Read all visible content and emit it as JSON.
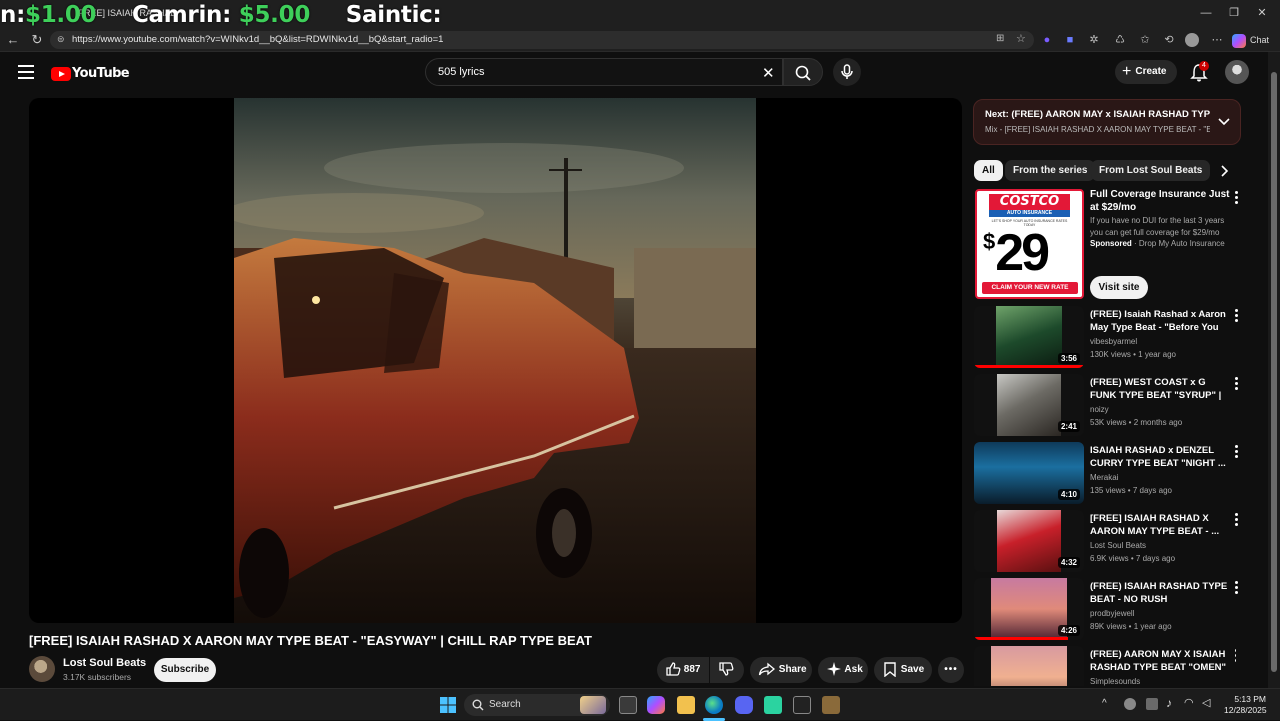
{
  "stream_overlay": {
    "segments": [
      {
        "prefix": "n:",
        "amount": "$1.00"
      },
      {
        "prefix": "Camrin:",
        "amount": "$5.00"
      },
      {
        "prefix": "Saintic:",
        "amount": ""
      }
    ]
  },
  "browser": {
    "tab_title": "[FREE] ISAIAH RASHAD",
    "url": "https://www.youtube.com/watch?v=WINkv1d__bQ&list=RDWINkv1d__bQ&start_radio=1",
    "chat_label": "Chat"
  },
  "youtube": {
    "logo_text": "YouTube",
    "search_value": "505 lyrics",
    "create_label": "Create",
    "notification_count": "4"
  },
  "video": {
    "title": "[FREE] ISAIAH RASHAD X AARON MAY TYPE BEAT - \"EASYWAY\" | CHILL RAP TYPE BEAT",
    "channel": "Lost Soul Beats",
    "subscribers": "3.17K subscribers",
    "subscribe_label": "Subscribe",
    "likes": "887",
    "share_label": "Share",
    "ask_label": "Ask",
    "save_label": "Save"
  },
  "sidebar": {
    "next_title": "Next: (FREE) AARON MAY x ISAIAH RASHAD TYPE ...",
    "next_sub": "Mix - [FREE] ISAIAH RASHAD X AARON MAY TYPE BEAT - \"E...",
    "chips": [
      "All",
      "From the series",
      "From Lost Soul Beats"
    ],
    "ad": {
      "logo": "COSTCO",
      "logo_sub": "AUTO INSURANCE",
      "tagline": "LET'S SHOP YOUR AUTO INSURANCE RATES TODAY",
      "price_symbol": "$",
      "price": "29",
      "cta": "CLAIM YOUR NEW RATE",
      "title": "Full Coverage Insurance Just at $29/mo",
      "description": "If you have no DUI for the last 3 years you can get full coverage for $29/mo",
      "sponsored": "Sponsored",
      "advertiser": "Drop My Auto Insurance",
      "visit_label": "Visit site"
    },
    "recommendations": [
      {
        "title": "(FREE) Isaiah Rashad x Aaron May Type Beat - \"Before You Go\"",
        "channel": "vibesbyarmel",
        "meta": "130K views • 1 year ago",
        "duration": "3:56",
        "watched": 1.0
      },
      {
        "title": "(FREE) WEST COAST x G FUNK TYPE BEAT \"SYRUP\" | CHILL ...",
        "channel": "noizy",
        "meta": "53K views • 2 months ago",
        "duration": "2:41",
        "watched": 0
      },
      {
        "title": "ISAIAH RASHAD x DENZEL CURRY TYPE BEAT \"NIGHT ...",
        "channel": "Merakai",
        "meta": "135 views • 7 days ago",
        "duration": "4:10",
        "watched": 0
      },
      {
        "title": "[FREE] ISAIAH RASHAD X AARON MAY TYPE BEAT - ...",
        "channel": "Lost Soul Beats",
        "meta": "6.9K views • 7 days ago",
        "duration": "4:32",
        "watched": 0
      },
      {
        "title": "(FREE) ISAIAH RASHAD TYPE BEAT - NO RUSH",
        "channel": "prodbyjewell",
        "meta": "89K views • 1 year ago",
        "duration": "4:26",
        "watched": 0.85
      },
      {
        "title": "(FREE) AARON MAY X ISAIAH RASHAD TYPE BEAT \"OMEN\" | ...",
        "channel": "Simplesounds",
        "meta": "",
        "duration": "",
        "watched": 0
      }
    ]
  },
  "taskbar": {
    "search_label": "Search",
    "time": "5:13 PM",
    "date": "12/28/2025"
  },
  "colors": {
    "accent_red": "#ff0000",
    "overlay_money": "#3ecf5a",
    "next_box_bg": "#2a1716"
  }
}
